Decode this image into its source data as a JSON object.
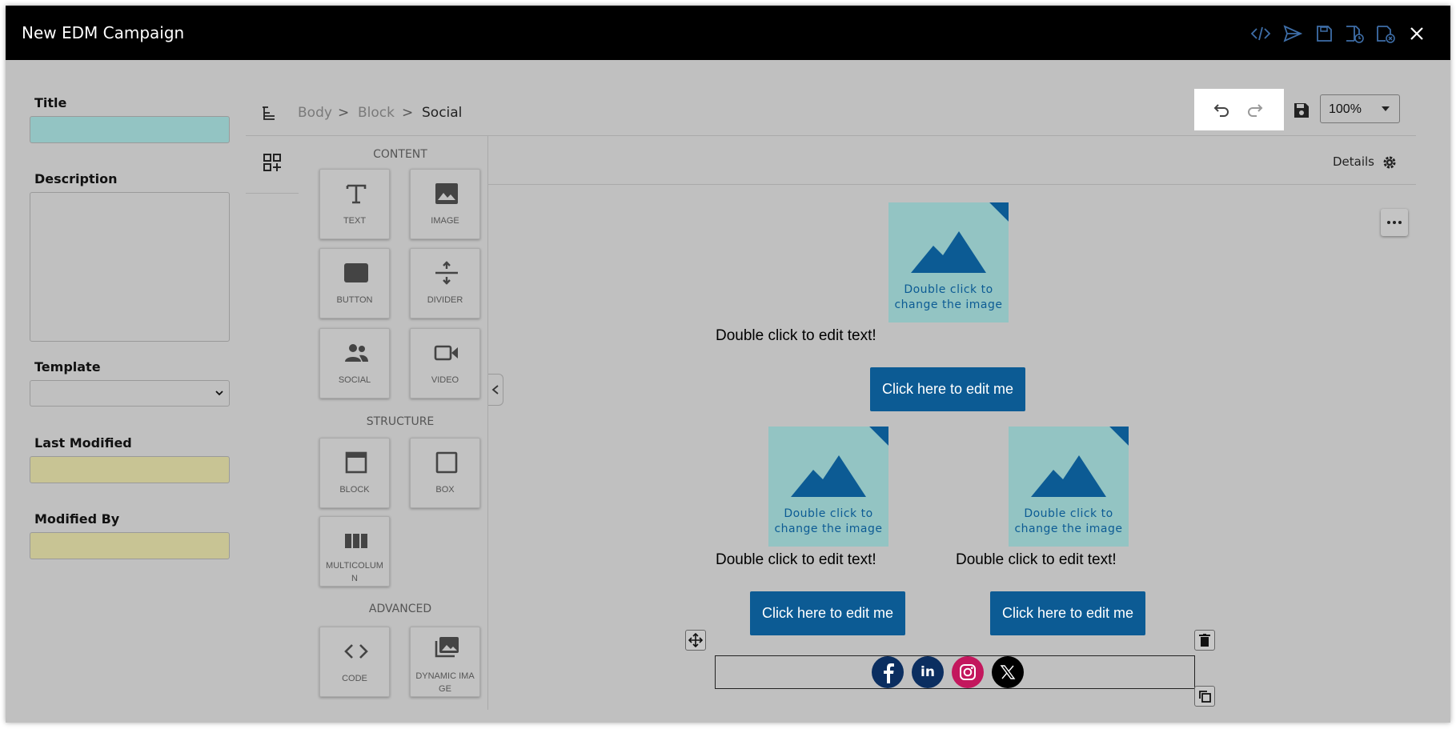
{
  "window": {
    "title": "New EDM Campaign"
  },
  "header_icons": [
    "code-icon",
    "send-icon",
    "save-icon",
    "save-schedule-icon",
    "save-close-icon",
    "close-icon"
  ],
  "form": {
    "title_label": "Title",
    "title_value": "",
    "description_label": "Description",
    "description_value": "",
    "template_label": "Template",
    "template_value": "",
    "last_modified_label": "Last Modified",
    "last_modified_value": "",
    "modified_by_label": "Modified By",
    "modified_by_value": ""
  },
  "breadcrumb": {
    "items": [
      "Body",
      "Block",
      "Social"
    ],
    "separator": ">"
  },
  "zoom": {
    "value": "100%"
  },
  "toolbox": {
    "content_title": "CONTENT",
    "structure_title": "STRUCTURE",
    "advanced_title": "ADVANCED",
    "content": [
      {
        "label": "TEXT",
        "icon": "text-icon"
      },
      {
        "label": "IMAGE",
        "icon": "image-icon"
      },
      {
        "label": "BUTTON",
        "icon": "button-icon"
      },
      {
        "label": "DIVIDER",
        "icon": "divider-icon"
      },
      {
        "label": "SOCIAL",
        "icon": "social-icon"
      },
      {
        "label": "VIDEO",
        "icon": "video-icon"
      }
    ],
    "structure": [
      {
        "label": "BLOCK",
        "icon": "block-icon"
      },
      {
        "label": "BOX",
        "icon": "box-icon"
      },
      {
        "label": "MULTICOLUMN",
        "icon": "multicolumn-icon"
      }
    ],
    "advanced": [
      {
        "label": "CODE",
        "icon": "code-icon"
      },
      {
        "label": "DYNAMIC IMAGE",
        "icon": "dynamic-image-icon"
      }
    ]
  },
  "canvas": {
    "details_label": "Details",
    "image_caption": "Double click to change the image",
    "text_placeholder": "Double click to edit text!",
    "button_label": "Click here to edit me",
    "social_icons": [
      "facebook-icon",
      "linkedin-icon",
      "instagram-icon",
      "x-icon"
    ],
    "social_letters": {
      "linkedin": "in"
    }
  },
  "colors": {
    "header": "#000000",
    "accent": "#0c5b94",
    "image_bg": "#93c4c3",
    "field_teal": "#93c4c3",
    "field_khaki": "#c8c494"
  }
}
